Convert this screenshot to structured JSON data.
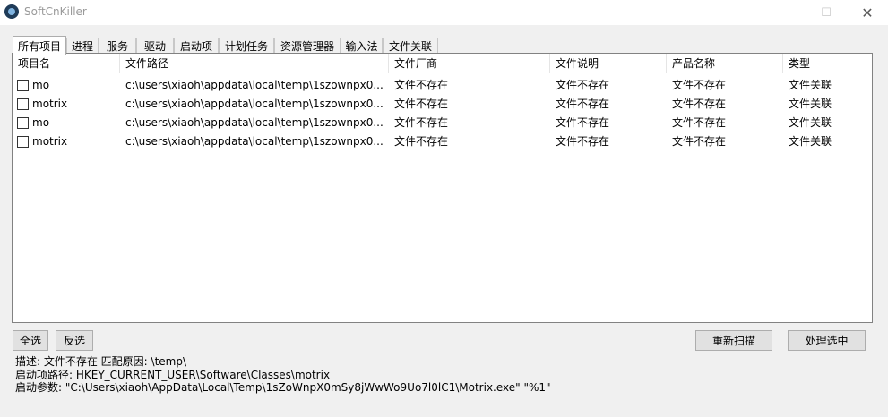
{
  "window": {
    "title": "SoftCnKiller",
    "minimize": "—",
    "maximize": "☐",
    "close": "✕"
  },
  "tabs": [
    "所有项目",
    "进程",
    "服务",
    "驱动",
    "启动项",
    "计划任务",
    "资源管理器",
    "输入法",
    "文件关联"
  ],
  "table": {
    "columns": [
      "项目名",
      "文件路径",
      "文件厂商",
      "文件说明",
      "产品名称",
      "类型"
    ],
    "rows": [
      {
        "name": "mo",
        "path": "c:\\users\\xiaoh\\appdata\\local\\temp\\1szownpx0...",
        "vendor": "文件不存在",
        "description": "文件不存在",
        "product": "文件不存在",
        "type": "文件关联",
        "checked": false
      },
      {
        "name": "motrix",
        "path": "c:\\users\\xiaoh\\appdata\\local\\temp\\1szownpx0...",
        "vendor": "文件不存在",
        "description": "文件不存在",
        "product": "文件不存在",
        "type": "文件关联",
        "checked": false
      },
      {
        "name": "mo",
        "path": "c:\\users\\xiaoh\\appdata\\local\\temp\\1szownpx0...",
        "vendor": "文件不存在",
        "description": "文件不存在",
        "product": "文件不存在",
        "type": "文件关联",
        "checked": false
      },
      {
        "name": "motrix",
        "path": "c:\\users\\xiaoh\\appdata\\local\\temp\\1szownpx0...",
        "vendor": "文件不存在",
        "description": "文件不存在",
        "product": "文件不存在",
        "type": "文件关联",
        "checked": false
      }
    ]
  },
  "buttons": {
    "select_all": "全选",
    "invert": "反选",
    "rescan": "重新扫描",
    "process_selected": "处理选中"
  },
  "info": {
    "description": "描述:  文件不存在    匹配原因: \\temp\\",
    "startup_path": "启动项路径:  HKEY_CURRENT_USER\\Software\\Classes\\motrix",
    "startup_args": "启动参数:  \"C:\\Users\\xiaoh\\AppData\\Local\\Temp\\1sZoWnpX0mSy8jWwWo9Uo7l0lC1\\Motrix.exe\" \"%1\""
  }
}
